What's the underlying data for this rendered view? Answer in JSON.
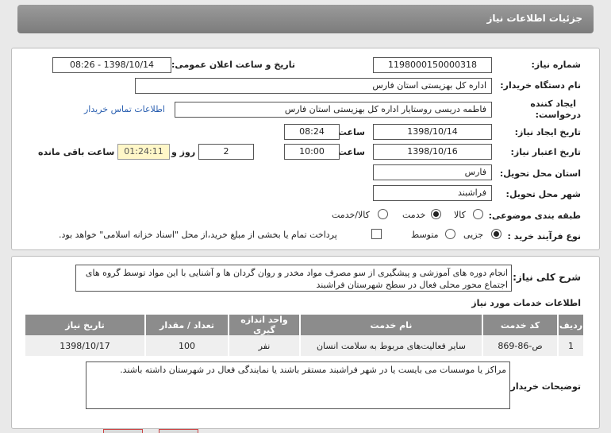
{
  "window": {
    "title": "جزئیات اطلاعات نیاز"
  },
  "info": {
    "need_number_label": "شماره نیاز:",
    "need_number": "1198000150000318",
    "announce_label": "تاریخ و ساعت اعلان عمومی:",
    "announce_value": "1398/10/14 - 08:26",
    "buyer_org_label": "نام دستگاه خریدار:",
    "buyer_org": "اداره کل بهزیستی استان فارس",
    "creator_label_1": "ایجاد کننده",
    "creator_label_2": "درخواست:",
    "creator": "فاطمه دریسی روستایار اداره کل بهزیستی استان فارس",
    "contact_link": "اطلاعات تماس خریدار",
    "created_date_label": "تاریخ ایجاد نیاز:",
    "created_date": "1398/10/14",
    "time_label": "ساعت",
    "created_time": "08:24",
    "valid_date_label": "تاریخ اعتبار نیاز:",
    "valid_date": "1398/10/16",
    "valid_time": "10:00",
    "days": "2",
    "days_label": "روز و",
    "remaining_time": "01:24:11",
    "remaining_label": "ساعت باقی مانده",
    "province_label": "استان محل تحویل:",
    "province": "فارس",
    "city_label": "شهر محل تحویل:",
    "city": "فراشبند",
    "category_label": "طبقه بندی موضوعی:",
    "category_options": [
      "کالا",
      "خدمت",
      "کالا/خدمت"
    ],
    "category_selected": "خدمت",
    "process_label": "نوع فرآیند خرید :",
    "process_options": [
      "جزیی",
      "متوسط"
    ],
    "process_selected": "جزیی",
    "treasury_note": "پرداخت تمام یا بخشی از مبلغ خرید،از محل \"اسناد خزانه اسلامی\" خواهد بود."
  },
  "description": {
    "label": "شرح کلی نیاز:",
    "text": "انجام دوره های آموزشی و پیشگیری از سو مصرف مواد مخدر و روان گردان ها و آشنایی با این مواد توسط گروه های اجتماع محور محلی فعال در سطح شهرستان فراشبند"
  },
  "services": {
    "title": "اطلاعات خدمات مورد نیاز",
    "headers": [
      "ردیف",
      "کد خدمت",
      "نام خدمت",
      "واحد اندازه گیری",
      "تعداد / مقدار",
      "تاریخ نیاز"
    ],
    "rows": [
      [
        "1",
        "ص-86-869",
        "سایر فعالیت‌های مربوط به سلامت انسان",
        "نفر",
        "100",
        "1398/10/17"
      ]
    ]
  },
  "buyer_notes": {
    "label": "توضیحات خریدار:",
    "text": "مراکز یا موسسات می بایست یا در شهر فراشبند مستقر باشند یا نمایندگی فعال در شهرستان داشته باشند."
  }
}
